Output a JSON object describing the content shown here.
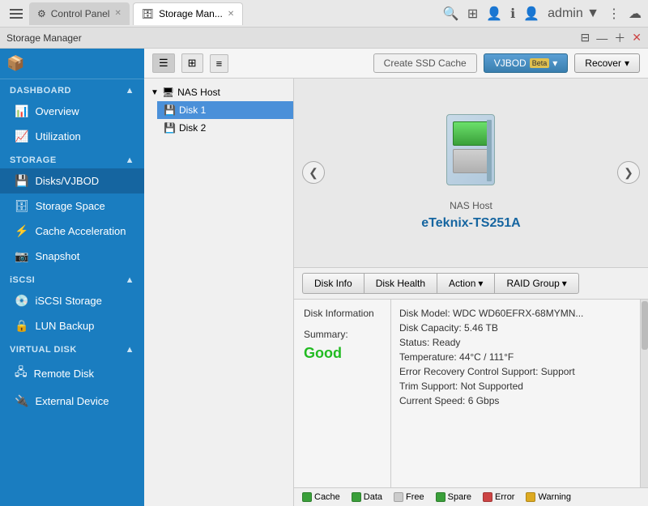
{
  "browser": {
    "tabs": [
      {
        "label": "Control Panel",
        "active": false
      },
      {
        "label": "Storage Man...",
        "active": true
      }
    ],
    "admin_label": "admin ▼"
  },
  "app": {
    "title": "Storage Manager",
    "icon": "🖥"
  },
  "sidebar": {
    "app_icon": "📦",
    "sections": [
      {
        "label": "DASHBOARD",
        "items": [
          {
            "label": "Overview",
            "icon": "📊"
          },
          {
            "label": "Utilization",
            "icon": "📈"
          }
        ]
      },
      {
        "label": "STORAGE",
        "items": [
          {
            "label": "Disks/VJBOD",
            "icon": "💾",
            "active": true
          },
          {
            "label": "Storage Space",
            "icon": "🗄"
          },
          {
            "label": "Cache Acceleration",
            "icon": "⚡"
          },
          {
            "label": "Snapshot",
            "icon": "📷"
          }
        ]
      },
      {
        "label": "iSCSI",
        "items": [
          {
            "label": "iSCSI Storage",
            "icon": "💿"
          },
          {
            "label": "LUN Backup",
            "icon": "🔒"
          }
        ]
      },
      {
        "label": "VIRTUAL DISK",
        "items": [
          {
            "label": "Remote Disk",
            "icon": "🖧"
          },
          {
            "label": "External Device",
            "icon": "🔌"
          }
        ]
      }
    ]
  },
  "toolbar": {
    "create_ssd_cache": "Create SSD Cache",
    "vjbod_beta": "VJBOD",
    "beta_label": "Beta",
    "recover": "Recover"
  },
  "tree": {
    "host_label": "NAS Host",
    "disk1_label": "Disk 1",
    "disk2_label": "Disk 2"
  },
  "device": {
    "host_label": "NAS Host",
    "device_name": "eTeknix-TS251A",
    "nav_left": "❮",
    "nav_right": "❯"
  },
  "disk_actions": {
    "disk_info": "Disk Info",
    "disk_health": "Disk Health",
    "action": "Action",
    "raid_group": "RAID Group"
  },
  "disk_info": {
    "section_label": "Disk Information",
    "summary_label": "Summary:",
    "summary_value": "Good",
    "rows": [
      "Disk Model: WDC WD60EFRX-68MYMN...",
      "Disk Capacity: 5.46 TB",
      "Status: Ready",
      "Temperature: 44°C / 111°F",
      "Error Recovery Control Support: Support",
      "Trim Support: Not Supported",
      "Current Speed: 6 Gbps"
    ]
  },
  "legend": [
    {
      "label": "Cache",
      "color": "#3a9f3a"
    },
    {
      "label": "Data",
      "color": "#3a9f3a"
    },
    {
      "label": "Free",
      "color": "#cccccc"
    },
    {
      "label": "Spare",
      "color": "#3a9f3a"
    },
    {
      "label": "Error",
      "color": "#cc4444"
    },
    {
      "label": "Warning",
      "color": "#ddaa22"
    }
  ]
}
